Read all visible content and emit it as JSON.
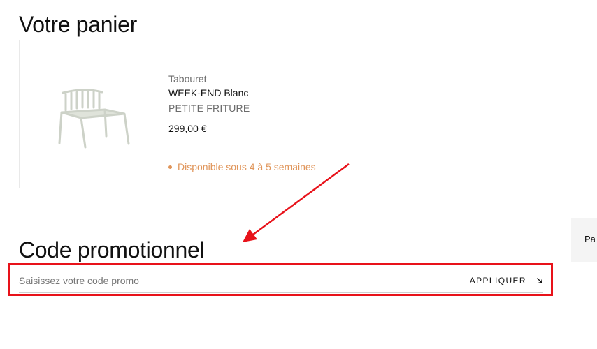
{
  "page": {
    "title": "Votre panier"
  },
  "cart": {
    "item": {
      "type": "Tabouret",
      "name": "WEEK-END Blanc",
      "brand": "PETITE FRITURE",
      "price": "299,00 €",
      "availability": "Disponible sous 4 à 5 semaines"
    }
  },
  "promo": {
    "title": "Code promotionnel",
    "placeholder": "Saisissez votre code promo",
    "value": "",
    "apply_label": "APPLIQUER",
    "apply_icon": "arrow-down-right-icon"
  },
  "side_panel": {
    "label_partial": "Pa"
  },
  "annotation": {
    "color": "#e8121a"
  },
  "colors": {
    "availability": "#e0955a"
  }
}
